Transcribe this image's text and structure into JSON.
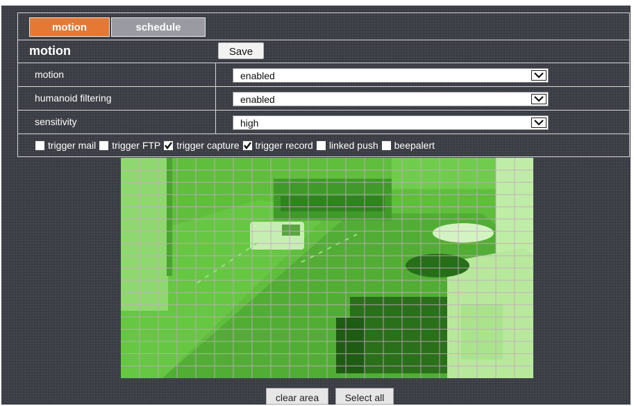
{
  "tabs": {
    "motion": "motion",
    "schedule": "schedule"
  },
  "section_title": "motion",
  "save_label": "Save",
  "rows": [
    {
      "label": "motion",
      "value": "enabled"
    },
    {
      "label": "humanoid filtering",
      "value": "enabled"
    },
    {
      "label": "sensitivity",
      "value": "high"
    }
  ],
  "checkboxes": [
    {
      "label": "trigger mail",
      "checked": false
    },
    {
      "label": "trigger FTP",
      "checked": false
    },
    {
      "label": "trigger capture",
      "checked": true
    },
    {
      "label": "trigger record",
      "checked": true
    },
    {
      "label": "linked push",
      "checked": false
    },
    {
      "label": "beepalert",
      "checked": false
    }
  ],
  "buttons": {
    "clear": "clear area",
    "select_all": "Select all"
  },
  "colors": {
    "active_tab": "#e57833",
    "inactive_tab": "#9a9aa2",
    "overlay": "#5cbd3a",
    "background": "#3b3d44"
  }
}
